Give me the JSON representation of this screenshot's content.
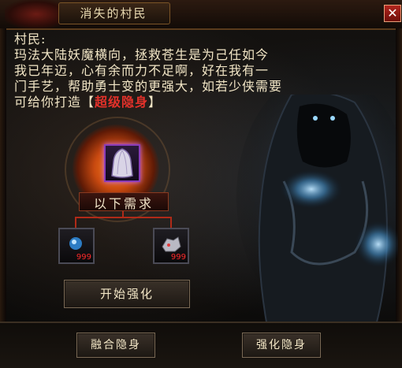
{
  "window": {
    "title": "消失的村民",
    "close_label": "✕"
  },
  "dialog": {
    "lines": [
      "村民:",
      "玛法大陆妖魔横向，拯救苍生是为己任如今",
      "我已年迈，心有余而力不足啊，好在我有一",
      "门手艺，帮助勇士变的更强大，如若少侠需要"
    ],
    "last_prefix": "可给你打造",
    "bracket_open": "【",
    "item_name": "超级隐身",
    "bracket_close": "】"
  },
  "crafting": {
    "target_item_icon": "invisibility-cloak-icon",
    "requirement_label": "以下需求",
    "materials": [
      {
        "icon": "blue-gem-icon",
        "count": "999"
      },
      {
        "icon": "silver-ore-icon",
        "count": "999"
      }
    ]
  },
  "buttons": {
    "start": "开始强化",
    "fuse": "融合隐身",
    "enhance": "强化隐身"
  },
  "colors": {
    "title_text": "#e8d9b0",
    "dialog_text": "#f2e6c6",
    "item_highlight": "#e3312a",
    "material_count": "#ff2a2a",
    "item_border": "#8a3cb8",
    "connector": "#b02a18"
  }
}
